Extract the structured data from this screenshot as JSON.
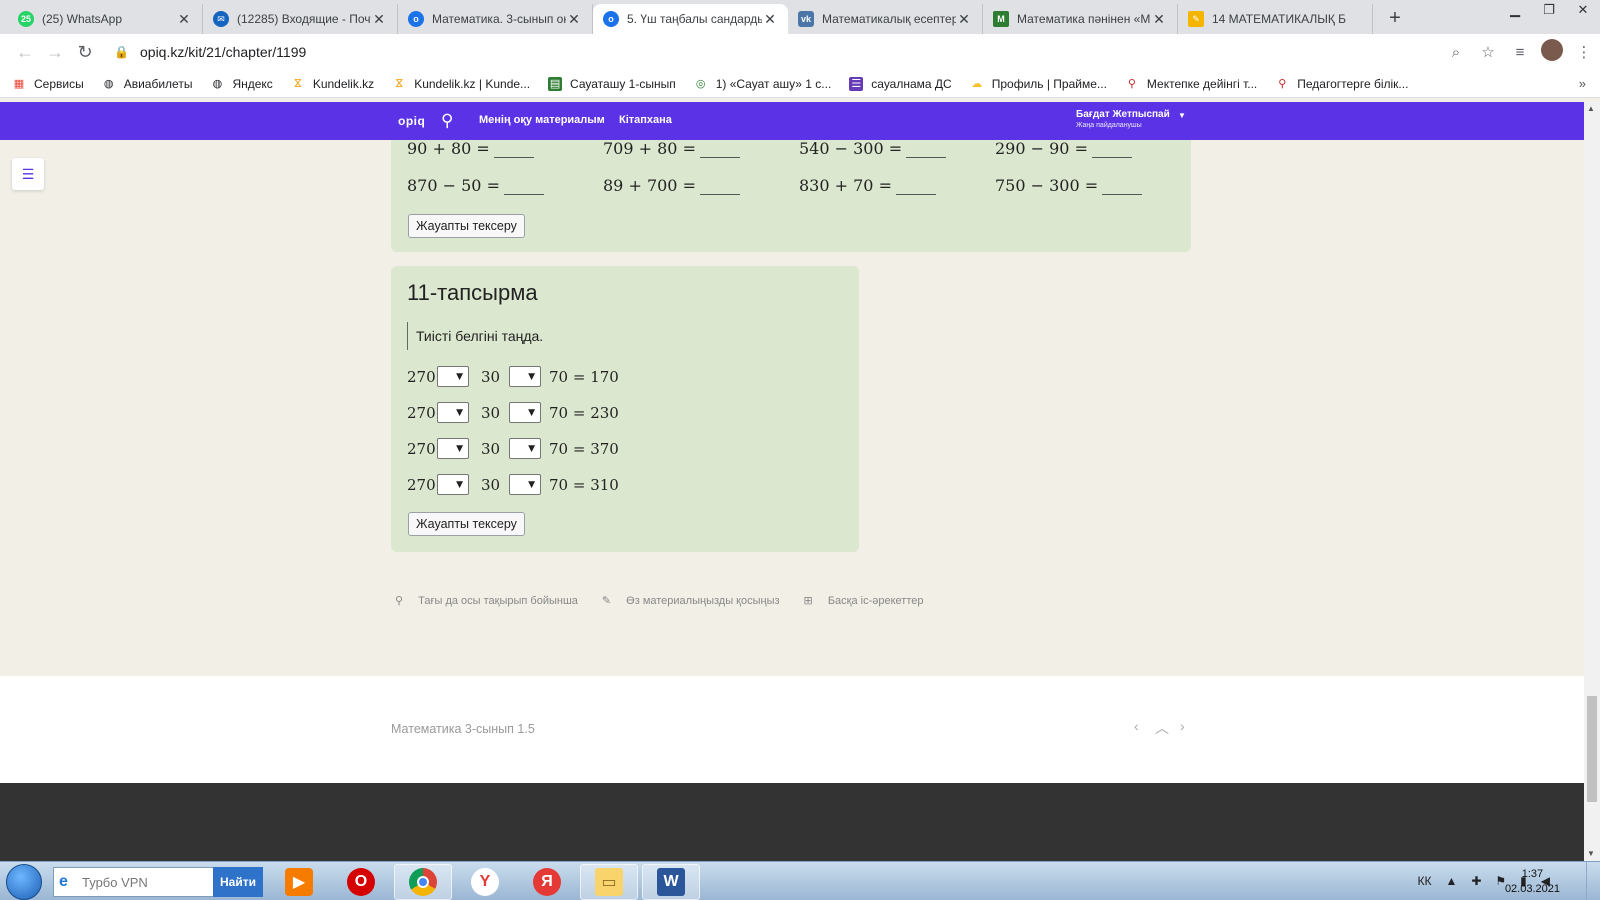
{
  "browser": {
    "tabs": [
      {
        "title": "(25) WhatsApp",
        "color": "#25d366",
        "glyph": "25"
      },
      {
        "title": "(12285) Входящие - Почт",
        "color": "#1565c0",
        "glyph": "✉"
      },
      {
        "title": "Математика. 3-сынып ок",
        "color": "#1a73e8",
        "glyph": "o"
      },
      {
        "title": "5. Үш таңбалы сандарды",
        "color": "#1a73e8",
        "glyph": "o"
      },
      {
        "title": "Математикалық есептер",
        "color": "#4a76a8",
        "glyph": "vk"
      },
      {
        "title": "Математика пәнінен «М",
        "color": "#2e7d32",
        "glyph": "M"
      },
      {
        "title": "14 МАТЕМАТИКАЛЫҚ Б",
        "color": "#f4b400",
        "glyph": "✎"
      }
    ],
    "active_tab": 3,
    "url": "opiq.kz/kit/21/chapter/1199",
    "bookmarks": [
      {
        "label": "Сервисы",
        "icon": "apps-grid-icon",
        "color": "#ea4335"
      },
      {
        "label": "Авиабилеты",
        "icon": "globe-icon",
        "color": "#555"
      },
      {
        "label": "Яндекс",
        "icon": "globe-icon",
        "color": "#555"
      },
      {
        "label": "Kundelik.kz",
        "icon": "kundelik-icon",
        "color": "#f9a825"
      },
      {
        "label": "Kundelik.kz | Kunde...",
        "icon": "kundelik-icon",
        "color": "#f9a825"
      },
      {
        "label": "Сауаташу 1-сынып",
        "icon": "book-icon",
        "color": "#2e7d32"
      },
      {
        "label": "1) «Сауат ашу» 1 с...",
        "icon": "globe-icon",
        "color": "#2e7d32"
      },
      {
        "label": "сауалнама ДС",
        "icon": "form-icon",
        "color": "#673ab7"
      },
      {
        "label": "Профиль | Прайме...",
        "icon": "cloud-icon",
        "color": "#fbc02d"
      },
      {
        "label": "Мектепке дейінгі т...",
        "icon": "search-icon",
        "color": "#c62828"
      },
      {
        "label": "Педагогтерге білік...",
        "icon": "search-icon",
        "color": "#c62828"
      }
    ]
  },
  "site": {
    "logo": "opiq",
    "nav": [
      "Менің оқу материалым",
      "Кітапхана"
    ],
    "user_name": "Бағдат Жетпыспай",
    "user_role": "Жаңа пайдаланушы"
  },
  "task10": {
    "rows": [
      [
        "90 + 80 =",
        "709 + 80 =",
        "540 − 300 =",
        "290 − 90 ="
      ],
      [
        "870 − 50 =",
        "89 + 700 =",
        "830 + 70 =",
        "750 − 300 ="
      ]
    ],
    "check_label": "Жауапты тексеру"
  },
  "task11": {
    "title": "11-тапсырма",
    "instruction": "Тиісті белгіні таңда.",
    "rows": [
      {
        "a": "270",
        "b": "30",
        "c": "70 = 170"
      },
      {
        "a": "270",
        "b": "30",
        "c": "70 = 230"
      },
      {
        "a": "270",
        "b": "30",
        "c": "70 = 370"
      },
      {
        "a": "270",
        "b": "30",
        "c": "70 = 310"
      }
    ],
    "check_label": "Жауапты тексеру"
  },
  "actions": [
    "Тағы да осы тақырып бойынша",
    "Өз материалыңызды қосыңыз",
    "Басқа іс-әрекеттер"
  ],
  "footer": {
    "book_title": "Математика 3-сынып 1.5"
  },
  "taskbar": {
    "search_placeholder": "Турбо VPN",
    "search_button": "Найти",
    "lang": "КК",
    "time": "1:37",
    "date": "02.03.2021"
  }
}
